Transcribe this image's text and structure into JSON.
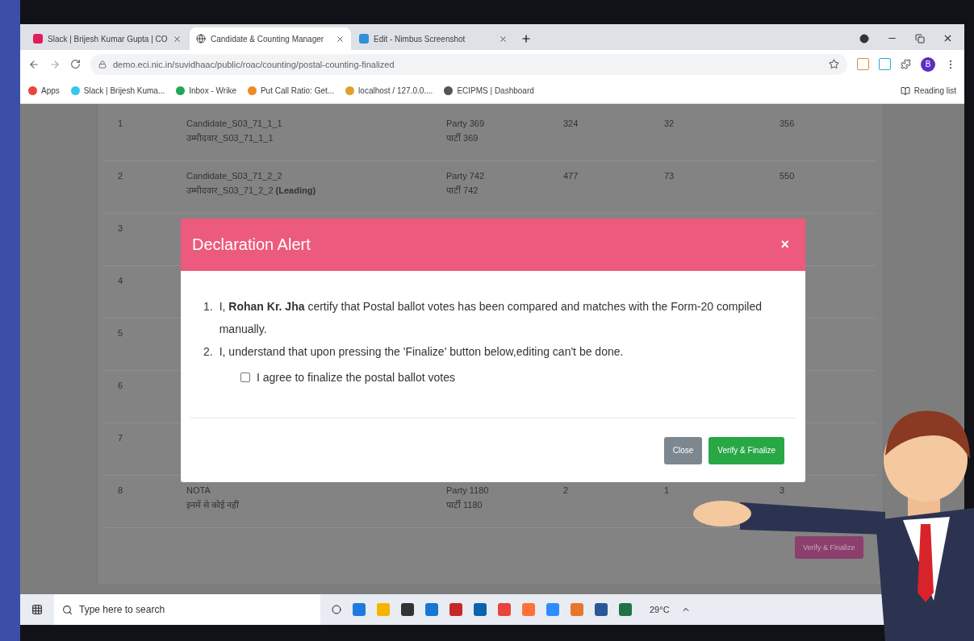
{
  "browser": {
    "tabs": [
      {
        "title": "Slack | Brijesh Kumar Gupta | CO",
        "selected": false
      },
      {
        "title": "Candidate & Counting Manager",
        "selected": true
      },
      {
        "title": "Edit - Nimbus Screenshot",
        "selected": false
      }
    ],
    "url": "demo.eci.nic.in/suvidhaac/public/roac/counting/postal-counting-finalized",
    "profile_initial": "B",
    "bookmarks": [
      {
        "label": "Apps",
        "color": "#e8453c"
      },
      {
        "label": "Slack | Brijesh Kuma...",
        "color": "#36c5f0"
      },
      {
        "label": "Inbox - Wrike",
        "color": "#22a65a"
      },
      {
        "label": "Put Call Ratio: Get...",
        "color": "#f08a24"
      },
      {
        "label": "localhost / 127.0.0....",
        "color": "#e0a030"
      },
      {
        "label": "ECIPMS | Dashboard",
        "color": "#555555"
      }
    ],
    "reading_list": "Reading list"
  },
  "table": {
    "rows": [
      {
        "number": "1",
        "candidate": "Candidate_S03_71_1_1",
        "candidate_local": "उम्मीदवार_S03_71_1_1",
        "party": "Party 369",
        "party_local": "पार्टी 369",
        "column_4": "324",
        "column_5": "32",
        "column_6": "356"
      },
      {
        "number": "2",
        "candidate": "Candidate_S03_71_2_2",
        "candidate_local": "उम्मीदवार_S03_71_2_2 **(Leading)**",
        "party": "Party 742",
        "party_local": "पार्टी 742",
        "column_4": "477",
        "column_5": "73",
        "column_6": "550"
      },
      {
        "number": "3"
      },
      {
        "number": "4"
      },
      {
        "number": "5"
      },
      {
        "number": "6"
      },
      {
        "number": "7"
      },
      {
        "number": "8",
        "candidate": "NOTA",
        "candidate_local": "इनमें से कोई नहीं",
        "party": "Party 1180",
        "party_local": "पार्टी 1180",
        "column_4": "2",
        "column_5": "1",
        "column_6": "3"
      }
    ],
    "button": "Verify & Finalize"
  },
  "modal": {
    "title": "Declaration Alert",
    "close_symbol": "×",
    "items": [
      {
        "number": "1.",
        "text": "I, **Rohan Kr. Jha** certify that Postal ballot votes has been compared and matches with the Form-20 compiled manually."
      },
      {
        "number": "2.",
        "text": "I, understand that upon pressing the 'Finalize' button below,editing can't be done."
      }
    ],
    "agree": {
      "label": "I agree to finalize the postal ballot votes",
      "checked": false
    },
    "buttons": [
      {
        "label": "Close",
        "kind": "secondary"
      },
      {
        "label": "Verify & Finalize",
        "kind": "primary"
      }
    ]
  },
  "taskbar": {
    "search_placeholder": "Type here to search",
    "temperature": "29°C"
  }
}
